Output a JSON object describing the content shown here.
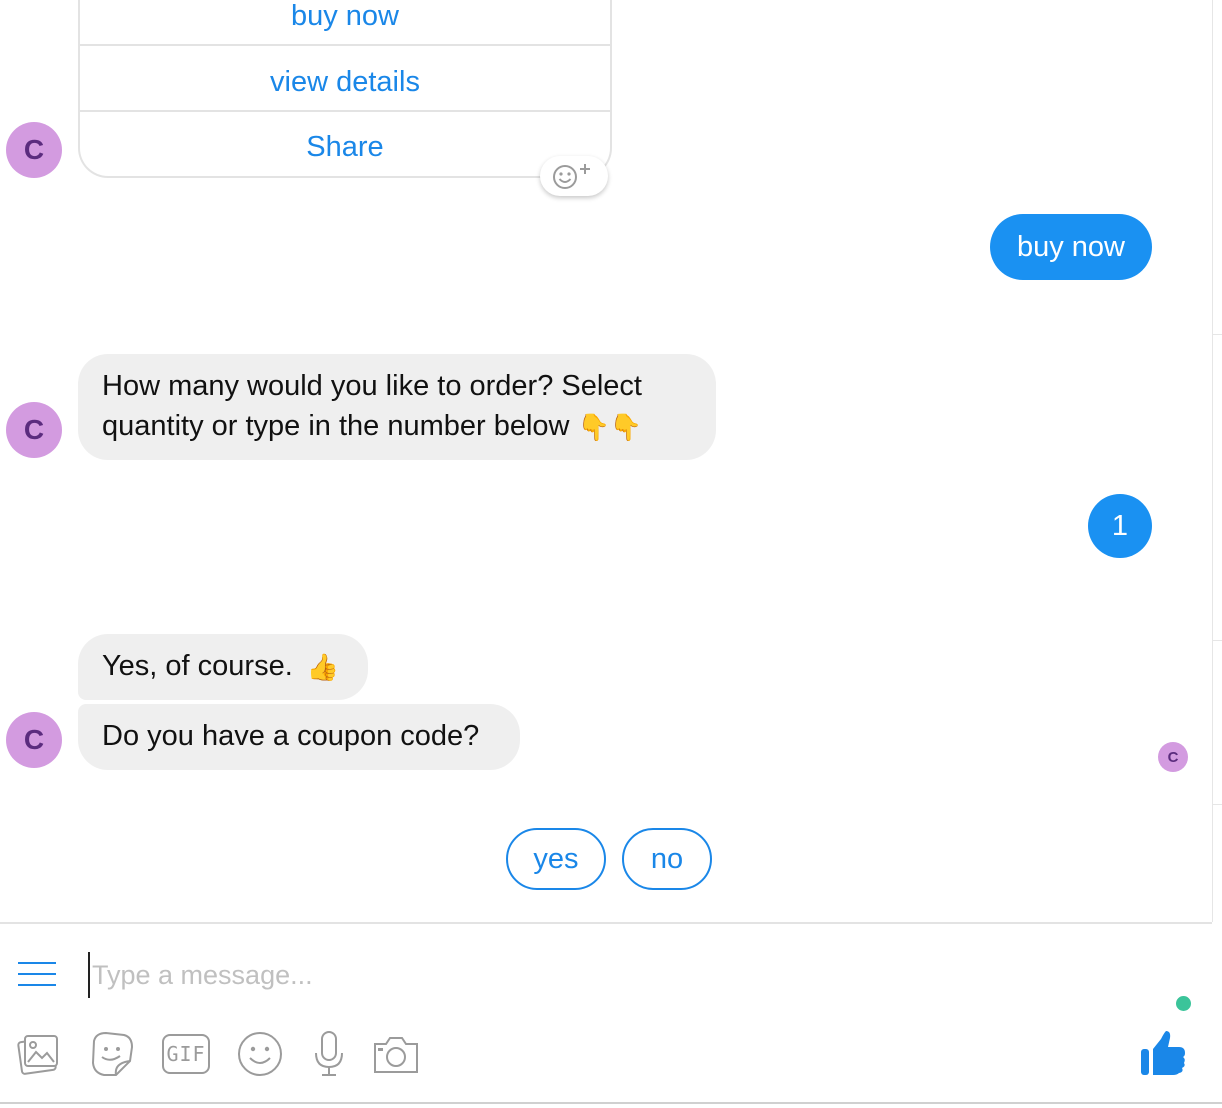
{
  "product_card": {
    "buttons": [
      {
        "label": "buy now"
      },
      {
        "label": "view details"
      },
      {
        "label": "Share"
      }
    ]
  },
  "bot": {
    "avatar_initial": "C"
  },
  "messages": {
    "user_1": "buy now",
    "bot_1": "How many would you like to order? Select quantity or type in the number below",
    "bot_1_emoji": "👇👇",
    "user_2": "1",
    "bot_2": "Yes, of course.",
    "bot_2_emoji": "👍",
    "bot_3": "Do you have a coupon code?"
  },
  "read_receipt_initial": "C",
  "quick_replies": [
    {
      "label": "yes"
    },
    {
      "label": "no"
    }
  ],
  "composer": {
    "placeholder": "Type a message...",
    "gif_label": "GIF"
  },
  "colors": {
    "accent": "#1a87e8",
    "outgoing_bubble": "#1a91f2",
    "incoming_bubble": "#efefef",
    "avatar": "#d39be0",
    "online": "#3bc49a"
  },
  "icons": {
    "reaction": "add-reaction-icon",
    "menu": "menu-icon",
    "image": "image-icon",
    "sticker": "sticker-icon",
    "gif": "gif-icon",
    "emoji": "emoji-icon",
    "mic": "microphone-icon",
    "camera": "camera-icon",
    "like": "thumbs-up-icon"
  }
}
